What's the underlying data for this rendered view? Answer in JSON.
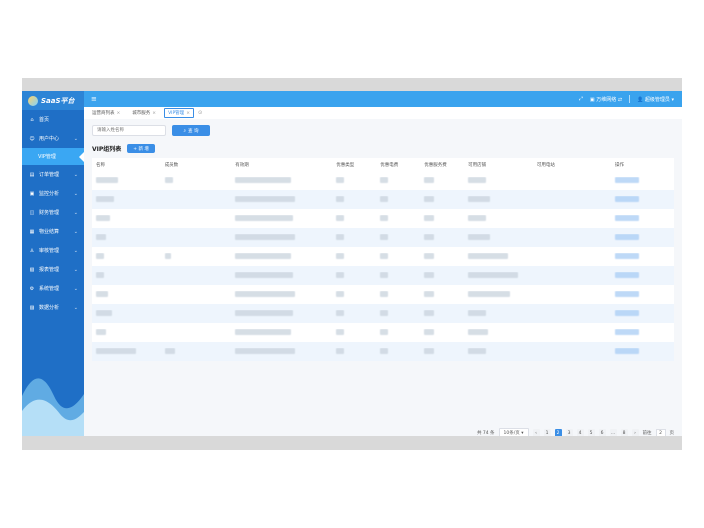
{
  "app": {
    "logo_text": "SaaS平台"
  },
  "sidebar": {
    "items": [
      {
        "label": "首页",
        "icon": "home-icon",
        "glyph": "⌂"
      },
      {
        "label": "用户中心",
        "icon": "user-icon",
        "glyph": "☺"
      },
      {
        "label": "VIP管理",
        "sub": true
      },
      {
        "label": "订单管理",
        "icon": "order-icon",
        "glyph": "▤"
      },
      {
        "label": "监控分析",
        "icon": "monitor-icon",
        "glyph": "▣"
      },
      {
        "label": "财务管理",
        "icon": "finance-icon",
        "glyph": "◫"
      },
      {
        "label": "物业结算",
        "icon": "settle-icon",
        "glyph": "▦"
      },
      {
        "label": "审核管理",
        "icon": "audit-icon",
        "glyph": "♙"
      },
      {
        "label": "报表管理",
        "icon": "report-icon",
        "glyph": "▧"
      },
      {
        "label": "系统管理",
        "icon": "settings-icon",
        "glyph": "⚙"
      },
      {
        "label": "数据分析",
        "icon": "analytics-icon",
        "glyph": "▨"
      }
    ]
  },
  "topbar": {
    "user_label": "超级管理员",
    "org_label": "万维网络"
  },
  "tabs": [
    {
      "label": "运营商列表",
      "active": false
    },
    {
      "label": "城市服务",
      "active": false
    },
    {
      "label": "VIP管理",
      "active": true
    }
  ],
  "search": {
    "placeholder": "请输入姓名称",
    "button_label": "查 询"
  },
  "list": {
    "title": "VIP组列表",
    "add_label": "+ 新 增"
  },
  "table": {
    "headers": [
      "名称",
      "成员数",
      "有效期",
      "优惠类型",
      "优惠电费",
      "优惠服务费",
      "可用店铺",
      "可用电站",
      "操作"
    ]
  },
  "pagination": {
    "total_text": "共 74 条",
    "page_size": "10条/页",
    "prev": "‹",
    "pages": [
      "1",
      "2",
      "3",
      "4",
      "5",
      "6",
      "…",
      "8"
    ],
    "active_page": "2",
    "next": "›",
    "jump_label": "前往",
    "jump_value": "2",
    "jump_suffix": "页"
  }
}
